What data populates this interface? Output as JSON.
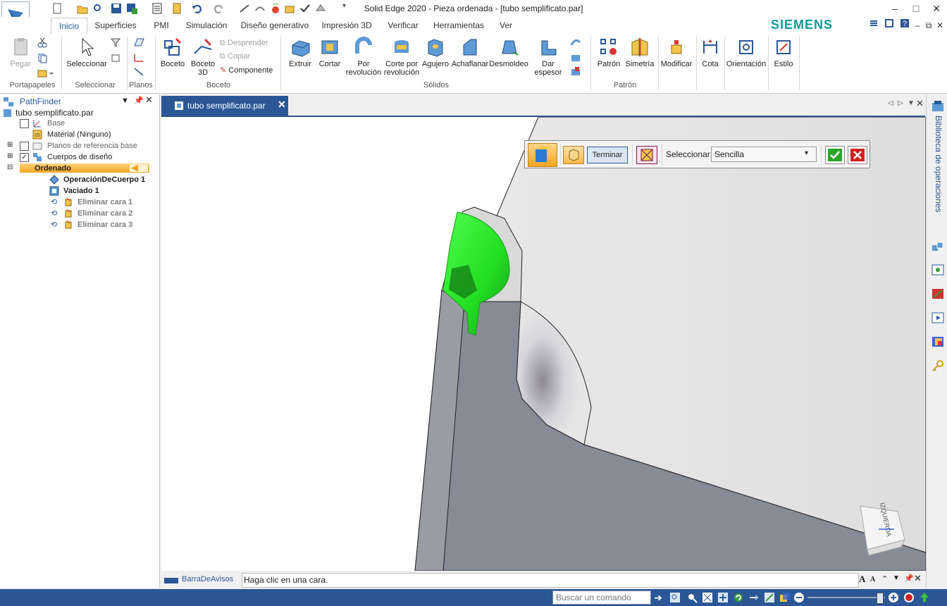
{
  "window": {
    "title": "Solid Edge 2020 - Pieza ordenada - [tubo semplificato.par]",
    "brand": "SIEMENS",
    "controls": [
      "–",
      "□",
      "✕"
    ],
    "mdi_controls": [
      "–",
      "⧉",
      "✕"
    ]
  },
  "tabs": [
    "Inicio",
    "Superficies",
    "PMI",
    "Simulación",
    "Diseño generativo",
    "Impresión 3D",
    "Verificar",
    "Herramientas",
    "Ver"
  ],
  "active_tab": "Inicio",
  "ribbon": {
    "portapapeles": {
      "paste": "Pegar",
      "group": "Portapapeles"
    },
    "seleccionar": {
      "select": "Seleccionar",
      "group": "Seleccionar"
    },
    "planos": {
      "group": "Planos"
    },
    "boceto": {
      "sketch": "Boceto",
      "sketch3d": "Boceto 3D",
      "desprender": "Desprender",
      "copiar": "Copiar",
      "componente": "Componente",
      "group": "Boceto"
    },
    "solidos": {
      "extruir": "Extruir",
      "cortar": "Cortar",
      "por_revolucion": "Por revolución",
      "corte_revolucion": "Corte por revolución",
      "agujero": "Agujero",
      "achaflanar": "Achaflanar",
      "desmoldeo": "Desmoldeo",
      "dar_espesor": "Dar espesor",
      "group": "Sólidos"
    },
    "patron": {
      "patron": "Patrón",
      "simetria": "Simetría",
      "group": "Patrón"
    },
    "modificar": "Modificar",
    "cota": "Cota",
    "orientacion": "Orientación",
    "estilo": "Estilo"
  },
  "pathfinder": {
    "title": "PathFinder",
    "root": "tubo semplificato.par",
    "items": [
      {
        "label": "Base"
      },
      {
        "label": "Material (Ninguno)"
      },
      {
        "label": "Planos de referencia base"
      },
      {
        "label": "Cuerpos de diseño"
      },
      {
        "label": "Ordenado"
      },
      {
        "label": "OperaciónDeCuerpo 1"
      },
      {
        "label": "Vaciado 1"
      },
      {
        "label": "Eliminar cara 1"
      },
      {
        "label": "Eliminar cara 2"
      },
      {
        "label": "Eliminar cara 3"
      }
    ]
  },
  "document_tab": "tubo semplificato.par",
  "command_bar": {
    "finish": "Terminar",
    "select_label": "Seleccionar:",
    "select_value": "Sencilla"
  },
  "right_panel": {
    "title": "Biblioteca de operaciones"
  },
  "view_cube": {
    "label": "IZQUIERDA"
  },
  "prompt": {
    "bar_label": "BarraDeAvisos",
    "message": "Haga clic en una cara."
  },
  "status": {
    "search_placeholder": "Buscar un comando"
  },
  "colors": {
    "accent": "#2b5797",
    "highlight": "#33ff33",
    "brand": "#129a9a"
  }
}
